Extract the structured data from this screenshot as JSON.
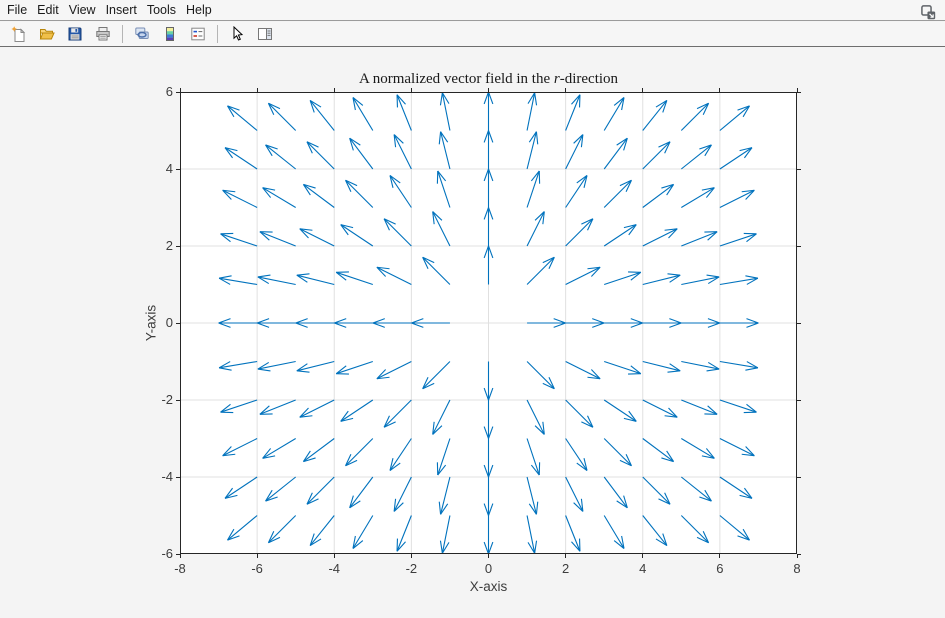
{
  "window": {
    "menu": {
      "items": [
        "File",
        "Edit",
        "View",
        "Insert",
        "Tools",
        "Help"
      ]
    },
    "toolbar": {
      "buttons": [
        {
          "icon": "new-figure-icon"
        },
        {
          "icon": "open-file-icon"
        },
        {
          "icon": "save-figure-icon"
        },
        {
          "icon": "print-figure-icon"
        },
        {
          "icon": "link-plot-icon"
        },
        {
          "icon": "insert-colorbar-icon"
        },
        {
          "icon": "insert-legend-icon"
        },
        {
          "icon": "edit-plot-icon"
        },
        {
          "icon": "show-plot-tools-icon"
        }
      ]
    },
    "popout_icon": "open-in-new-window-icon"
  },
  "figure": {
    "title_parts": {
      "prefix": "A normalized vector field in the ",
      "italic": "r",
      "suffix": "-direction"
    }
  },
  "chart_data": {
    "type": "quiver",
    "title": "A normalized vector field in the r-direction",
    "xlabel": "X-axis",
    "ylabel": "Y-axis",
    "xlim": [
      -8,
      8
    ],
    "ylim": [
      -6,
      6
    ],
    "xticks": [
      -8,
      -6,
      -4,
      -2,
      0,
      2,
      4,
      6,
      8
    ],
    "yticks": [
      -6,
      -4,
      -2,
      0,
      2,
      4,
      6
    ],
    "grid": true,
    "field": {
      "description": "Unit radial vectors u = x/r, v = y/r with r = sqrt(x^2+y^2), plotted at integer grid points; the origin (0,0) is undefined and skipped; arrows are clipped at the axes limits",
      "x_min": -6,
      "x_max": 6,
      "y_min": -6,
      "y_max": 6,
      "step": 1,
      "arrow_length_units": 1.0
    },
    "legend": "none"
  },
  "colors": {
    "vector": "#0072BD",
    "grid": "#e0e0e0",
    "axis": "#262626",
    "label": "#3d3d3d",
    "figure_bg": "#f4f4f4",
    "chrome_bg": "#f6f6f6"
  }
}
